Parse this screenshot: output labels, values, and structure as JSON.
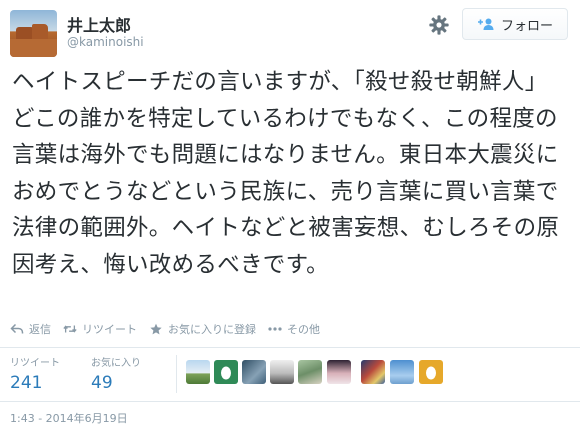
{
  "user": {
    "display_name": "井上太郎",
    "handle": "@kaminoishi",
    "avatar_icon": "desert-landscape-avatar"
  },
  "header": {
    "settings_icon": "gear-icon",
    "follow_label": "フォロー",
    "follow_icon": "add-user-icon"
  },
  "tweet": {
    "text": "ヘイトスピーチだの言いますが、「殺せ殺せ朝鮮人」どこの誰かを特定しているわけでもなく、この程度の言葉は海外でも問題にはなりません。東日本大震災におめでとうなどという民族に、売り言葉に買い言葉で法律の範囲外。ヘイトなどと被害妄想、むしろその原因考え、悔い改めるべきです。"
  },
  "actions": {
    "reply": "返信",
    "retweet": "リツイート",
    "favorite": "お気に入りに登録",
    "more": "その他"
  },
  "stats": {
    "retweets_label": "リツイート",
    "retweets_count": "241",
    "favorites_label": "お気に入り",
    "favorites_count": "49"
  },
  "timestamp": "1:43 - 2014年6月19日",
  "colors": {
    "text": "#292f33",
    "muted": "#8899a6",
    "count": "#2b7bb9",
    "border": "#e1e8ed"
  }
}
